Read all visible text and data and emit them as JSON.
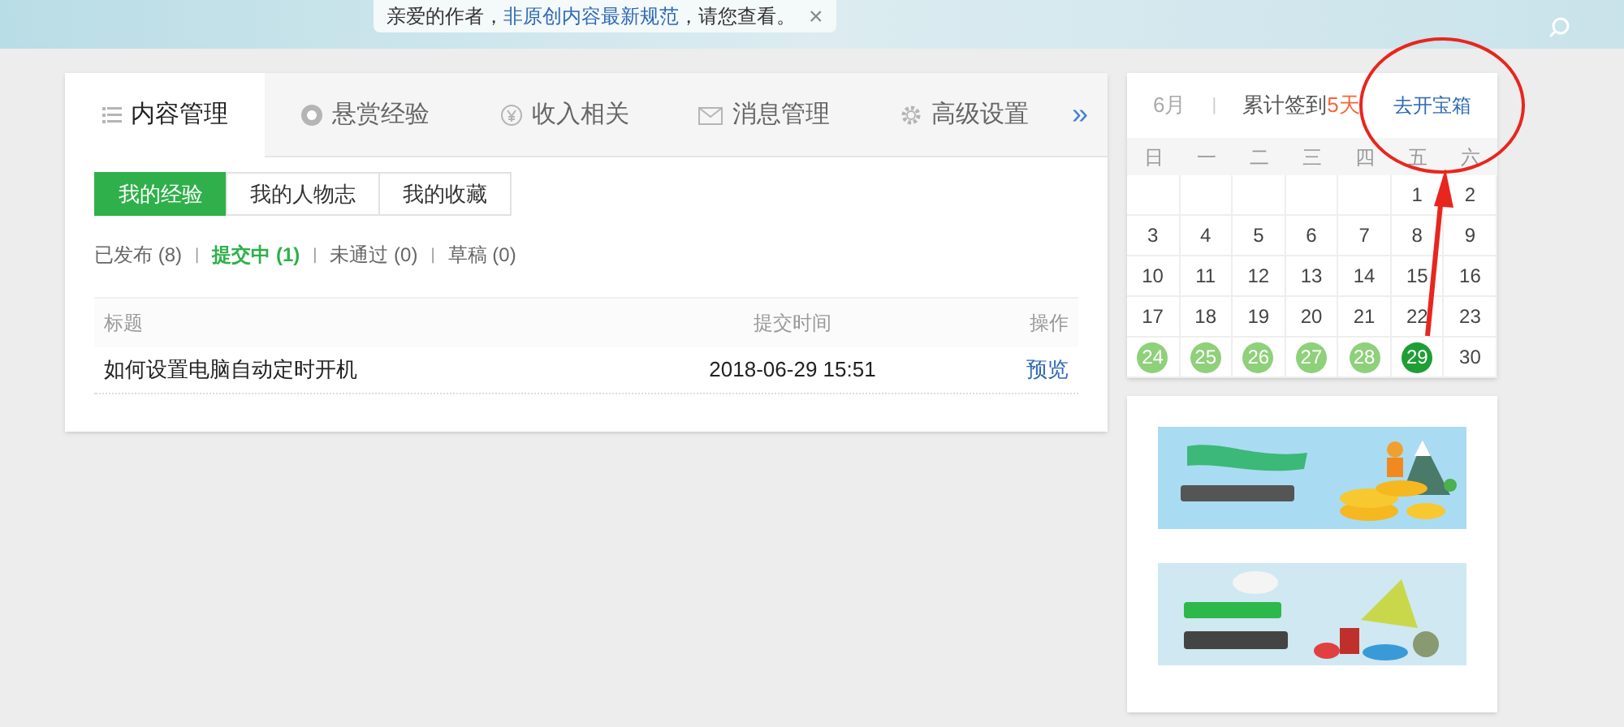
{
  "notice": {
    "text": "亲爱的作者，**非原创内容最新规范**，请您查看。",
    "close": "×"
  },
  "tabs": [
    {
      "label": "内容管理",
      "selected": true
    },
    {
      "label": "悬赏经验",
      "selected": false
    },
    {
      "label": "收入相关",
      "selected": false
    },
    {
      "label": "消息管理",
      "selected": false
    },
    {
      "label": "高级设置",
      "selected": false
    }
  ],
  "tabs_more": "»",
  "subtabs": [
    {
      "label": "我的经验",
      "selected": true
    },
    {
      "label": "我的人物志",
      "selected": false
    },
    {
      "label": "我的收藏",
      "selected": false
    }
  ],
  "filters": [
    {
      "label": "已发布 (8)",
      "selected": false
    },
    {
      "label": "提交中 (1)",
      "selected": true
    },
    {
      "label": "未通过 (0)",
      "selected": false
    },
    {
      "label": "草稿 (0)",
      "selected": false
    }
  ],
  "filter_separator": "|",
  "table": {
    "columns": [
      "标题",
      "提交时间",
      "操作"
    ],
    "rows": [
      {
        "title": "如何设置电脑自动定时开机",
        "time": "2018-06-29 15:51",
        "action": "预览"
      }
    ]
  },
  "calendar": {
    "month": "6月",
    "separator": "|",
    "streak_label": "累计签到",
    "streak_value": "5天",
    "link": "去开宝箱",
    "weekdays": [
      "日",
      "一",
      "二",
      "三",
      "四",
      "五",
      "六"
    ],
    "days": [
      {
        "day": "1",
        "signed": false,
        "today": false
      },
      {
        "day": "2",
        "signed": false,
        "today": false
      },
      {
        "day": "3",
        "signed": false,
        "today": false
      },
      {
        "day": "4",
        "signed": false,
        "today": false
      },
      {
        "day": "5",
        "signed": false,
        "today": false
      },
      {
        "day": "6",
        "signed": false,
        "today": false
      },
      {
        "day": "7",
        "signed": false,
        "today": false
      },
      {
        "day": "8",
        "signed": false,
        "today": false
      },
      {
        "day": "9",
        "signed": false,
        "today": false
      },
      {
        "day": "10",
        "signed": false,
        "today": false
      },
      {
        "day": "11",
        "signed": false,
        "today": false
      },
      {
        "day": "12",
        "signed": false,
        "today": false
      },
      {
        "day": "13",
        "signed": false,
        "today": false
      },
      {
        "day": "14",
        "signed": false,
        "today": false
      },
      {
        "day": "15",
        "signed": false,
        "today": false
      },
      {
        "day": "16",
        "signed": false,
        "today": false
      },
      {
        "day": "17",
        "signed": false,
        "today": false
      },
      {
        "day": "18",
        "signed": false,
        "today": false
      },
      {
        "day": "19",
        "signed": false,
        "today": false
      },
      {
        "day": "20",
        "signed": false,
        "today": false
      },
      {
        "day": "21",
        "signed": false,
        "today": false
      },
      {
        "day": "22",
        "signed": false,
        "today": false
      },
      {
        "day": "23",
        "signed": false,
        "today": false
      },
      {
        "day": "24",
        "signed": true,
        "today": false
      },
      {
        "day": "25",
        "signed": true,
        "today": false
      },
      {
        "day": "26",
        "signed": true,
        "today": false
      },
      {
        "day": "27",
        "signed": true,
        "today": false
      },
      {
        "day": "28",
        "signed": true,
        "today": false
      },
      {
        "day": "29",
        "signed": true,
        "today": true
      },
      {
        "day": "30",
        "signed": false,
        "today": false
      }
    ]
  }
}
